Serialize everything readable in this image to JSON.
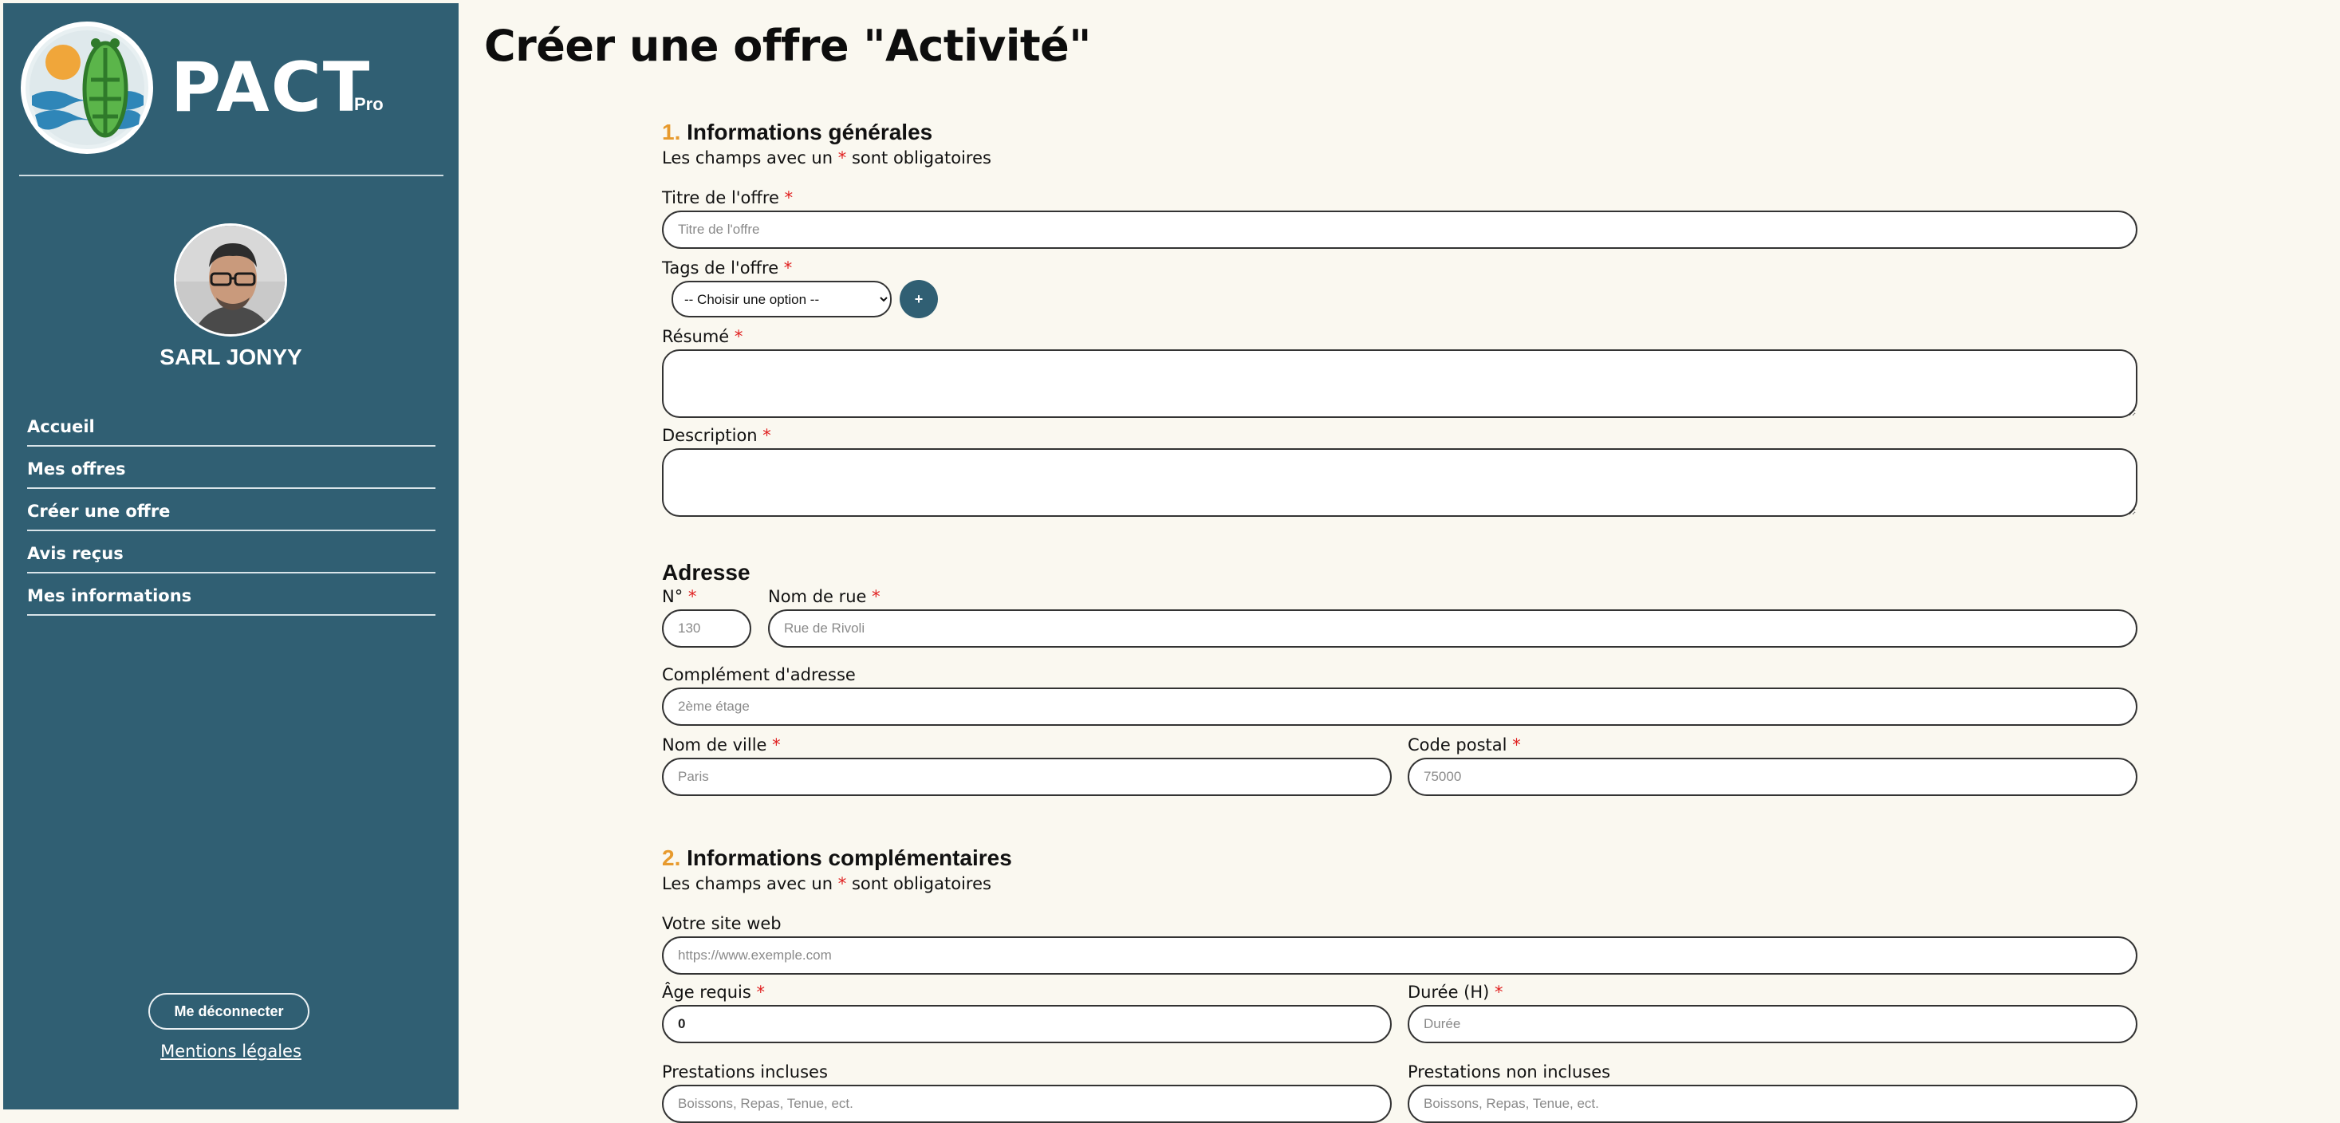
{
  "sidebar": {
    "brand": "PACT",
    "brand_sub": "Pro",
    "company_name": "SARL JONYY",
    "nav": [
      "Accueil",
      "Mes offres",
      "Créer une offre",
      "Avis reçus",
      "Mes informations"
    ],
    "logout_label": "Me déconnecter",
    "legal_label": "Mentions légales"
  },
  "page": {
    "title": "Créer une offre \"Activité\""
  },
  "form": {
    "required_mark": "*",
    "section1": {
      "number": "1.",
      "title": "Informations générales",
      "hint_before": "Les champs avec un",
      "hint_after": "sont obligatoires"
    },
    "titre": {
      "label": "Titre de l'offre",
      "placeholder": "Titre de l'offre"
    },
    "tags": {
      "label": "Tags de l'offre",
      "selected": "-- Choisir une option --",
      "add_label": "+"
    },
    "resume": {
      "label": "Résumé"
    },
    "description": {
      "label": "Description"
    },
    "adresse": {
      "title": "Adresse",
      "numero": {
        "label": "N°",
        "placeholder": "130"
      },
      "rue": {
        "label": "Nom de rue",
        "placeholder": "Rue de Rivoli"
      },
      "complement": {
        "label": "Complément d'adresse",
        "placeholder": "2ème étage"
      },
      "ville": {
        "label": "Nom de ville",
        "placeholder": "Paris"
      },
      "code_postal": {
        "label": "Code postal",
        "placeholder": "75000"
      }
    },
    "section2": {
      "number": "2.",
      "title": "Informations complémentaires",
      "hint_before": "Les champs avec un",
      "hint_after": "sont obligatoires"
    },
    "site_web": {
      "label": "Votre site web",
      "placeholder": "https://www.exemple.com"
    },
    "age": {
      "label": "Âge requis",
      "value": "0"
    },
    "duree": {
      "label": "Durée (H)",
      "placeholder": "Durée"
    },
    "prestations_incluses": {
      "label": "Prestations incluses",
      "placeholder": "Boissons, Repas, Tenue, ect."
    },
    "prestations_non_incluses": {
      "label": "Prestations non incluses",
      "placeholder": "Boissons, Repas, Tenue, ect."
    }
  },
  "colors": {
    "sidebar_bg": "#305f73",
    "page_bg": "#faf8f0",
    "accent_number": "#e79a2d",
    "required": "#e02020"
  }
}
